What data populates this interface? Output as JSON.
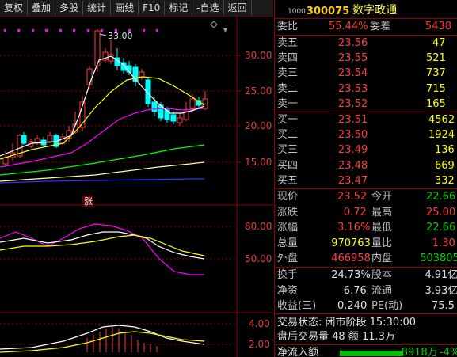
{
  "toolbar": {
    "items": [
      "复权",
      "叠加",
      "多股",
      "统计",
      "画线",
      "F10",
      "标记",
      "-自选",
      "返回"
    ]
  },
  "chart": {
    "main_price_labels": [
      "33.00",
      "30.00",
      "25.00",
      "20.00",
      "15.00"
    ],
    "high_mark": "33.00",
    "zhang_mark": "涨",
    "kdj_labels": [
      "80.00",
      "50.00"
    ],
    "macd_labels": [
      "4.00",
      "2.00"
    ]
  },
  "stock": {
    "code_prefix": "1000",
    "code": "300075",
    "name": "数字政通"
  },
  "order_ratio": {
    "label1": "委比",
    "value1": "55.44%",
    "label2": "委差",
    "value2": "5438"
  },
  "asks": [
    {
      "label": "卖五",
      "price": "23.56",
      "vol": "47"
    },
    {
      "label": "卖四",
      "price": "23.55",
      "vol": "521"
    },
    {
      "label": "卖三",
      "price": "23.54",
      "vol": "737"
    },
    {
      "label": "卖二",
      "price": "23.53",
      "vol": "715"
    },
    {
      "label": "卖一",
      "price": "23.52",
      "vol": "165"
    }
  ],
  "bids": [
    {
      "label": "买一",
      "price": "23.51",
      "vol": "4562"
    },
    {
      "label": "买二",
      "price": "23.50",
      "vol": "1924"
    },
    {
      "label": "买三",
      "price": "23.49",
      "vol": "136"
    },
    {
      "label": "买四",
      "price": "23.48",
      "vol": "669"
    },
    {
      "label": "买五",
      "price": "23.47",
      "vol": "332"
    }
  ],
  "quote": [
    {
      "l1": "现价",
      "v1": "23.52",
      "c1": "red",
      "l2": "今开",
      "v2": "22.66",
      "c2": "green"
    },
    {
      "l1": "涨跌",
      "v1": "0.72",
      "c1": "red",
      "l2": "最高",
      "v2": "25.00",
      "c2": "red"
    },
    {
      "l1": "涨幅",
      "v1": "3.16%",
      "c1": "red",
      "l2": "最低",
      "v2": "22.66",
      "c2": "green"
    },
    {
      "l1": "总量",
      "v1": "970763",
      "c1": "yellow",
      "l2": "量比",
      "v2": "1.30",
      "c2": "red"
    },
    {
      "l1": "外盘",
      "v1": "466958",
      "c1": "red",
      "l2": "内盘",
      "v2": "503805",
      "c2": "green"
    }
  ],
  "fundamentals": [
    {
      "l1": "换手",
      "v1": "24.73%",
      "l2": "股本",
      "v2": "4.91亿"
    },
    {
      "l1": "净资",
      "v1": "6.76",
      "l2": "流通",
      "v2": "3.93亿"
    },
    {
      "l1": "收益(三)",
      "v1": "0.240",
      "l2": "PE(动)",
      "v2": "75.5"
    }
  ],
  "status": {
    "trade_status": "交易状态: 闭市阶段 15:30:00",
    "after_hours": "盘后交易量 48 额 11.3万",
    "net_inflow_label": "净流入额",
    "net_inflow_value": "-8918万",
    "net_inflow_pct": "-4%"
  },
  "colors": {
    "up": "#ff3c3c",
    "down": "#00ffff",
    "ma5": "#ffffff",
    "ma10": "#ffff00",
    "ma20": "#ff00ff",
    "ma30": "#00ff00",
    "ma60": "#ffffaa",
    "ma120": "#3030ff",
    "grid": "#8b0000"
  }
}
